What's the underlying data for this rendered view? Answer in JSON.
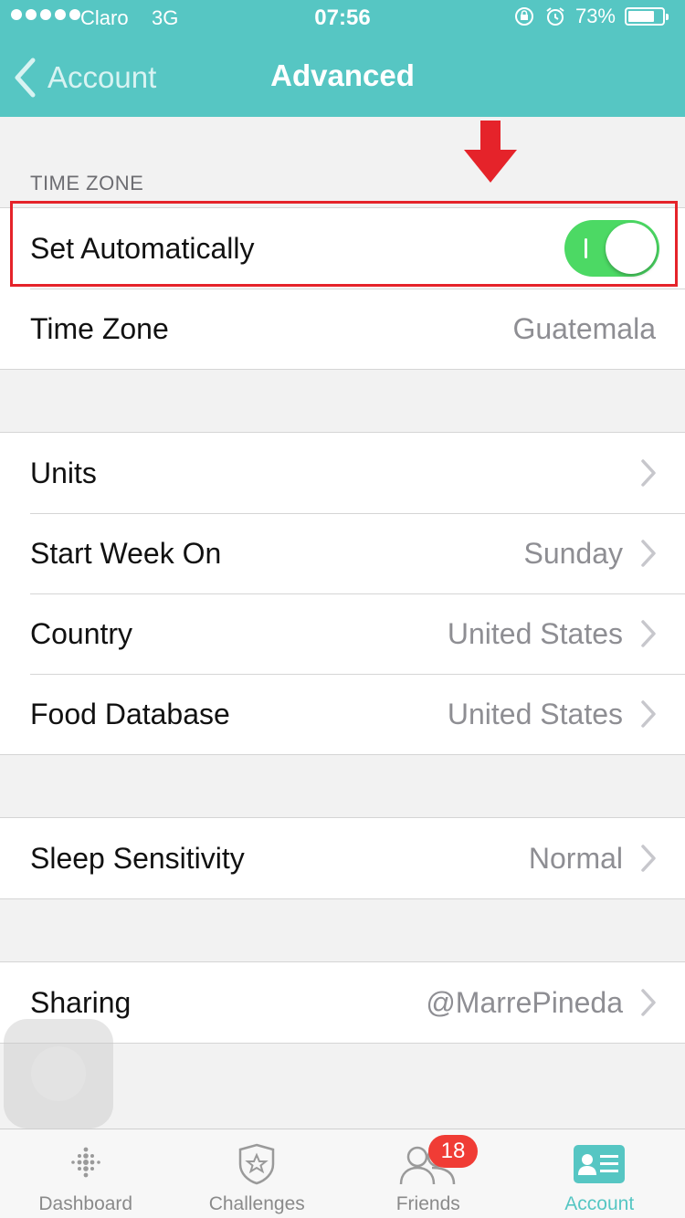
{
  "status_bar": {
    "carrier": "Claro",
    "network": "3G",
    "time": "07:56",
    "battery": "73%"
  },
  "nav": {
    "back_label": "Account",
    "title": "Advanced"
  },
  "time_zone_section": {
    "header": "TIME ZONE",
    "set_automatically": {
      "label": "Set Automatically",
      "on": true
    },
    "time_zone": {
      "label": "Time Zone",
      "value": "Guatemala"
    }
  },
  "general": {
    "units": {
      "label": "Units"
    },
    "start_week_on": {
      "label": "Start Week On",
      "value": "Sunday"
    },
    "country": {
      "label": "Country",
      "value": "United States"
    },
    "food_database": {
      "label": "Food Database",
      "value": "United States"
    }
  },
  "sleep": {
    "sensitivity": {
      "label": "Sleep Sensitivity",
      "value": "Normal"
    }
  },
  "sharing": {
    "label": "Sharing",
    "value": "@MarrePineda"
  },
  "tabbar": {
    "dashboard": "Dashboard",
    "challenges": "Challenges",
    "friends": "Friends",
    "friends_badge": "18",
    "account": "Account"
  },
  "colors": {
    "accent": "#56c6c3",
    "toggle_on": "#4cd964",
    "annotation": "#e5232a",
    "badge": "#f03c35"
  }
}
